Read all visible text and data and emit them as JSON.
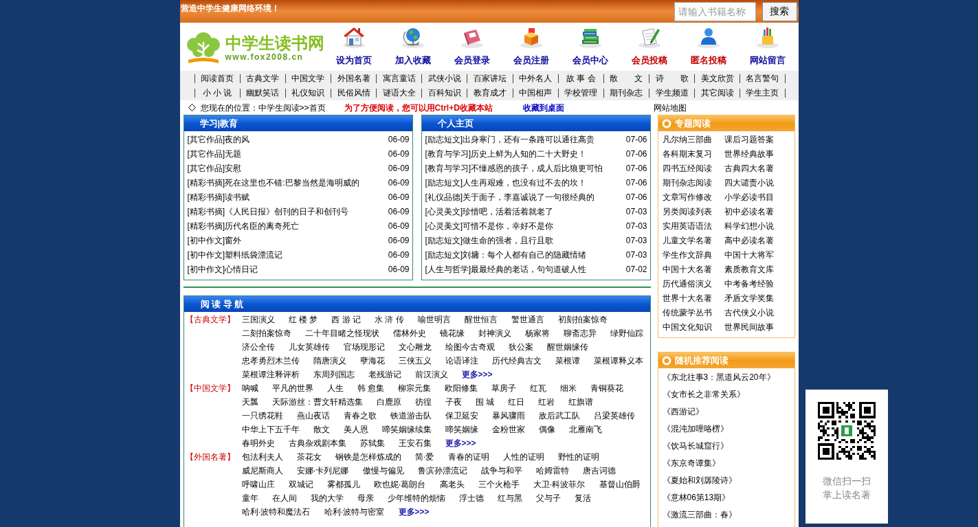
{
  "top_bar": {
    "slogan": "营造中学生健康网络环境！",
    "search": {
      "placeholder": "请输入书籍名称"
    },
    "search_button": "搜索"
  },
  "logo": {
    "title": "中学生读书网",
    "url": "www.fox2008.cn"
  },
  "header_links": [
    {
      "label": "设为首页",
      "color": "#0a0a9e"
    },
    {
      "label": "加入收藏",
      "color": "#0a0a9e"
    },
    {
      "label": "会员登录",
      "color": "#0a0a9e"
    },
    {
      "label": "会员注册",
      "color": "#0a0a9e"
    },
    {
      "label": "会员中心",
      "color": "#0a0a9e"
    },
    {
      "label": "会员投稿",
      "color": "#c40000"
    },
    {
      "label": "匿名投稿",
      "color": "#c40000"
    },
    {
      "label": "网站留言",
      "color": "#0a0a9e"
    }
  ],
  "category_nav": {
    "rows": [
      [
        "阅读首页",
        "古典文学",
        "中国文学",
        "外国名著",
        "寓言童话",
        "武侠小说",
        "百家讲坛",
        "中外名人",
        "故 事 会",
        "散　　文",
        "诗　　歌",
        "美文欣赏",
        "名言警句"
      ],
      [
        "小 小 说",
        "幽默笑话",
        "礼仪知识",
        "民俗风情",
        "谜语大全",
        "百科知识",
        "教育成才",
        "中国相声",
        "学校管理",
        "期刊杂志",
        "学生频道",
        "其它阅读",
        "学生主页"
      ]
    ]
  },
  "breadcrumb": {
    "location": "您现在的位置：中学生阅读>>首页",
    "notice": "为了方便阅读，您可以用Ctrl+D收藏本站",
    "desktop_link": "收藏到桌面",
    "sitemap_link": "网站地图"
  },
  "news_panels": [
    {
      "title": "学习|教育",
      "items": [
        {
          "title": "[其它作品]夜的风",
          "date": "06-09"
        },
        {
          "title": "[其它作品]无题",
          "date": "06-09"
        },
        {
          "title": "[其它作品]安慰",
          "date": "06-09"
        },
        {
          "title": "[精彩书摘]死在这里也不错:巴黎当然是海明威的",
          "date": "06-09"
        },
        {
          "title": "[精彩书摘]读书赋",
          "date": "06-09"
        },
        {
          "title": "[精彩书摘]《人民日报》创刊的日子和创刊号",
          "date": "06-09"
        },
        {
          "title": "[精彩书摘]历代名臣的离奇死亡",
          "date": "06-09"
        },
        {
          "title": "[初中作文]窗外",
          "date": "06-09"
        },
        {
          "title": "[初中作文]塑料纸袋漂流记",
          "date": "06-09"
        },
        {
          "title": "[初中作文]心情日记",
          "date": "06-09"
        }
      ]
    },
    {
      "title": "个人主页",
      "items": [
        {
          "title": "[励志短文]出身寒门，还有一条路可以通往高贵",
          "date": "07-06"
        },
        {
          "title": "[教育与学习]历史上鲜为人知的二十大野史！",
          "date": "07-06"
        },
        {
          "title": "[教育与学习]不懂感恩的孩子，成人后比狼更可怕",
          "date": "07-06"
        },
        {
          "title": "[励志短文]人生再艰难，也没有过不去的坎！",
          "date": "07-06"
        },
        {
          "title": "[礼仪品德]关于面子，李嘉诚说了一句很经典的",
          "date": "07-06"
        },
        {
          "title": "[心灵美文]珍惜吧，活着活着就老了",
          "date": "07-03"
        },
        {
          "title": "[心灵美文]可惜不是你，幸好不是你",
          "date": "07-03"
        },
        {
          "title": "[励志短文]做生命的强者，且行且歌",
          "date": "07-03"
        },
        {
          "title": "[励志短文]刘墉：每个人都有自己的隐藏情绪",
          "date": "07-03"
        },
        {
          "title": "[人生与哲学]最最经典的老话，句句道破人性",
          "date": "07-02"
        }
      ]
    }
  ],
  "reading_nav": {
    "title": "阅 读 导 航",
    "sections": [
      {
        "category": "【古典文学】",
        "books": [
          "三国演义",
          "红 楼 梦",
          "西 游 记",
          "水 浒 传",
          "喻世明言",
          "醒世恒言",
          "警世通言",
          "初刻拍案惊奇",
          "二刻拍案惊奇",
          "二十年目睹之怪现状",
          "儒林外史",
          "镜花缘",
          "封神演义",
          "杨家将",
          "聊斋志异",
          "绿野仙踪",
          "济公全传",
          "儿女英雄传",
          "官场现形记",
          "文心雕龙",
          "绘图今古奇观",
          "狄公案",
          "醒世姻缘传",
          "忠孝勇烈木兰传",
          "隋唐演义",
          "孽海花",
          "三侠五义",
          "论语译注",
          "历代经典古文",
          "菜根谭",
          "菜根谭释义本",
          "菜根谭注释评析",
          "东周列国志",
          "老残游记",
          "前汉演义"
        ],
        "more": "更多>>>"
      },
      {
        "category": "【中国文学】",
        "books": [
          "呐喊",
          "平凡的世界",
          "人生",
          "韩 愈集",
          "柳宗元集",
          "欧阳修集",
          "草房子",
          "红瓦",
          "细米",
          "青铜葵花",
          "天瓢",
          "天际游丝：曹文轩精选集",
          "白鹿原",
          "彷徨",
          "子夜",
          "围 城",
          "红日",
          "红岩",
          "红旗谱",
          "一只绣花鞋",
          "燕山夜话",
          "青春之歌",
          "铁道游击队",
          "保卫延安",
          "暴风骤雨",
          "敌后武工队",
          "吕梁英雄传",
          "中华上下五千年",
          "散文",
          "美人恩",
          "啼笑姻缘续集",
          "啼笑姻缘",
          "金粉世家",
          "偶像",
          "北雁南飞",
          "春明外史",
          "古典杂戏剧本集",
          "苏轼集",
          "王安石集"
        ],
        "more": "更多>>>"
      },
      {
        "category": "【外国名著】",
        "books": [
          "包法利夫人",
          "茶花女",
          "钢铁是怎样炼成的",
          "简·爱",
          "青春的证明",
          "人性的证明",
          "野性的证明",
          "威尼斯商人",
          "安娜·卡列尼娜",
          "傲慢与偏见",
          "鲁滨孙漂流记",
          "战争与和平",
          "哈姆雷特",
          "唐吉诃德",
          "呼啸山庄",
          "双城记",
          "雾都孤儿",
          "欧也妮·葛朗台",
          "高老头",
          "三个火枪手",
          "大卫·科波菲尔",
          "基督山伯爵",
          "童年",
          "在人间",
          "我的大学",
          "母亲",
          "少年维特的烦恼",
          "浮士德",
          "红与黑",
          "父与子",
          "复活",
          "哈利·波特和魔法石",
          "哈利·波特与密室"
        ],
        "more": "更多>>>"
      }
    ]
  },
  "topics": {
    "title": "专题阅读",
    "items": [
      "凡尔纳三部曲",
      "课后习题答案",
      "各科期末复习",
      "世界经典故事",
      "四书五经阅读",
      "古典四大名著",
      "期刊杂志阅读",
      "四大谴责小说",
      "文章写作修改",
      "小学必读书目",
      "另类阅读列表",
      "初中必读名著",
      "实用英语语法",
      "科学幻想小说",
      "儿童文学名著",
      "高中必读名著",
      "学生作文辞典",
      "中国十大将军",
      "中国十大名著",
      "素质教育文库",
      "历代通俗演义",
      "中考备考经验",
      "世界十大名著",
      "矛盾文学奖集",
      "传统蒙学丛书",
      "古代侠义小说",
      "中国文化知识",
      "世界民间故事"
    ]
  },
  "recommended": {
    "title": "随机推荐阅读",
    "items": [
      "《东北往事3：黑道风云20年》",
      "《女市长之非常关系》",
      "《西游记》",
      "《混沌加哩咯楞》",
      "《饮马长城窟行》",
      "《东京奇谭集》",
      "《夏始和刘孱陵诗》",
      "《意林06第13期》",
      "《激流三部曲：春》"
    ]
  },
  "qr_widget": {
    "lines": [
      "微信扫一扫",
      "掌上读名著"
    ]
  }
}
